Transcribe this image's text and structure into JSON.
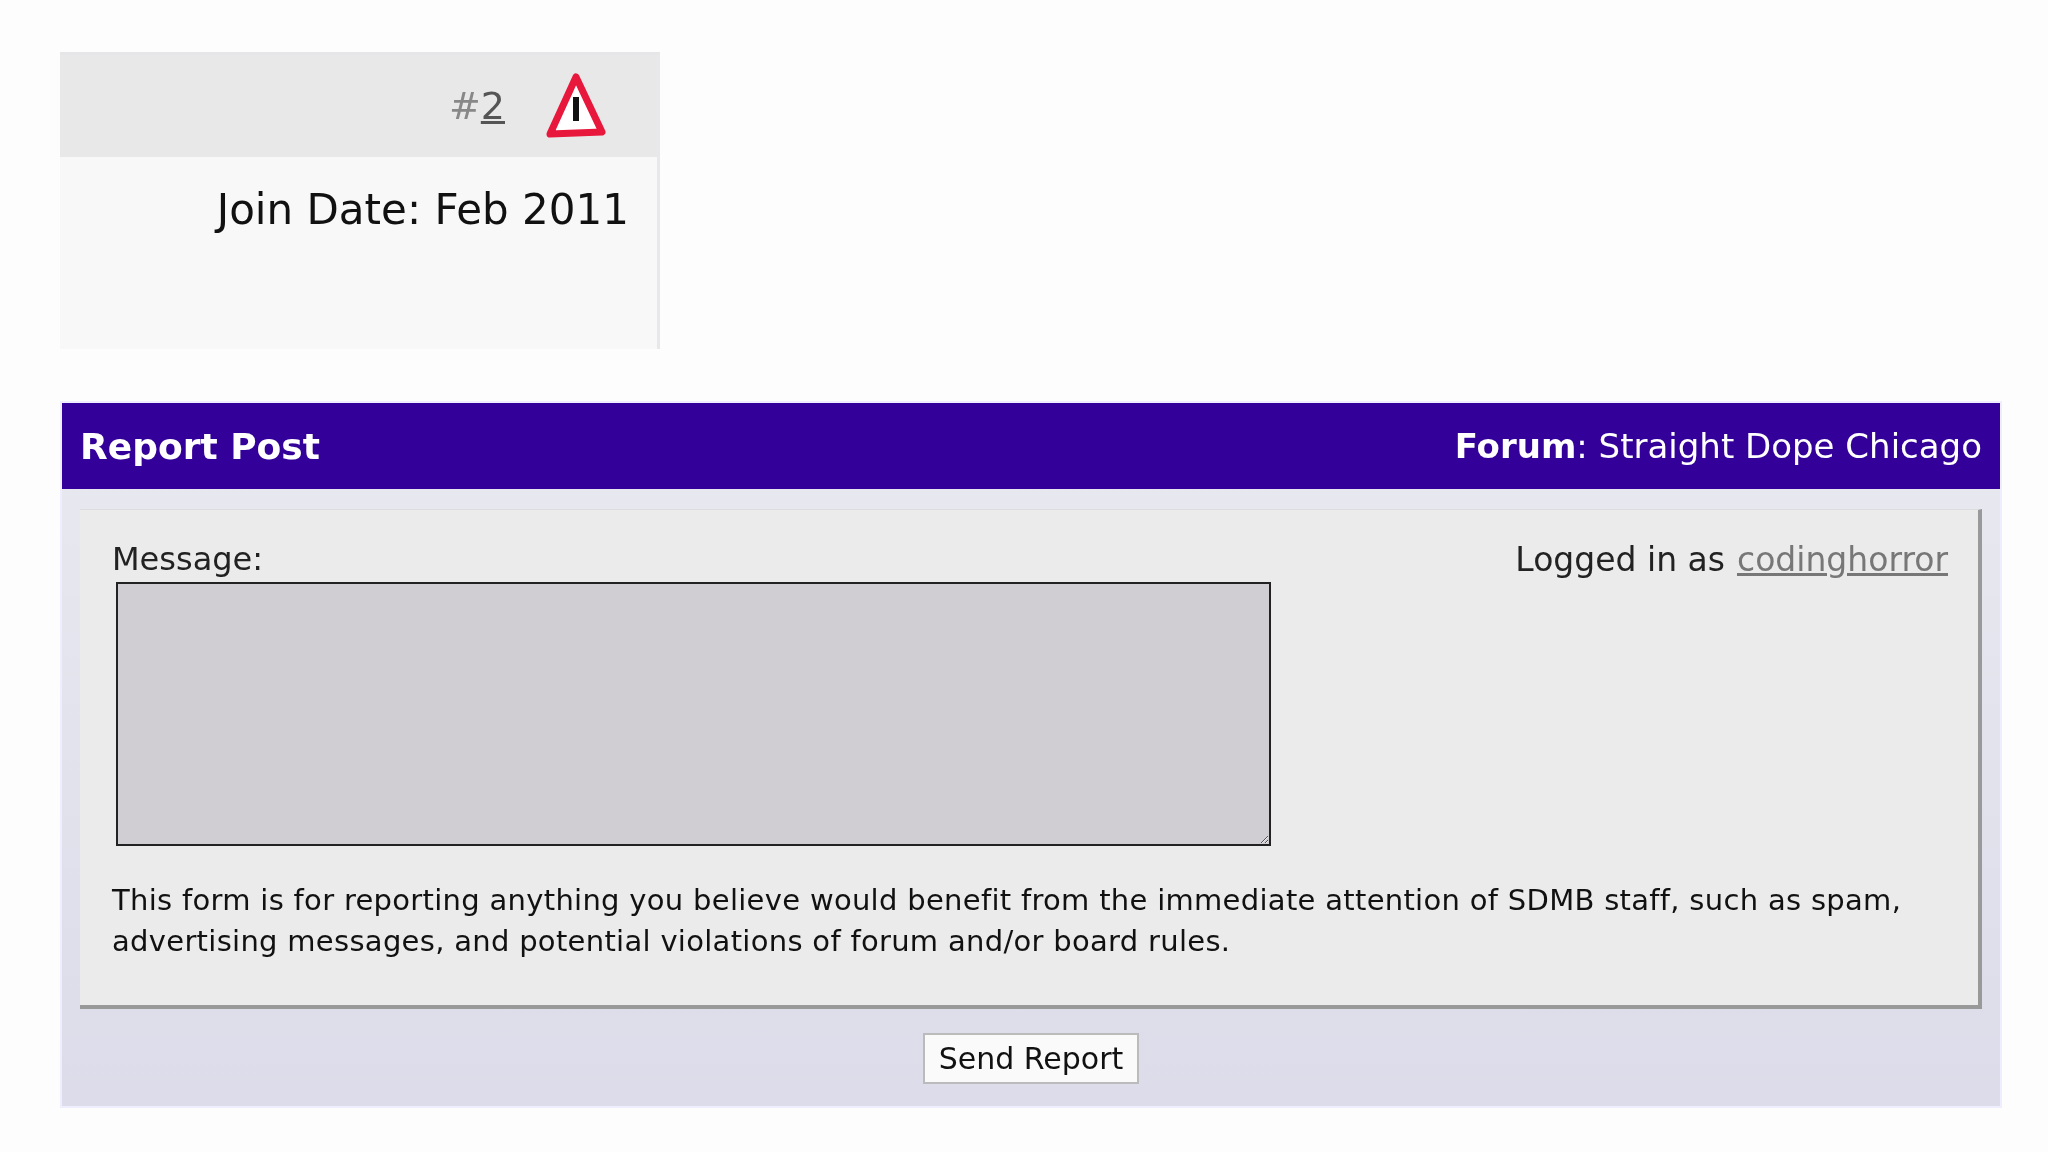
{
  "post_card": {
    "hash": "#",
    "post_number": "2",
    "join_date": "Join Date: Feb 2011"
  },
  "report_form": {
    "title": "Report Post",
    "forum": "**Forum**: Straight Dope Chicago",
    "message_label": "Message:",
    "logged_in_prefix": "Logged in as",
    "username": "codinghorror",
    "notice": "This form is for reporting anything you believe would benefit from the immediate attention of SDMB staff, such as spam, advertising messages, and potential violations of forum and/or board rules.",
    "submit": "Send Report"
  }
}
